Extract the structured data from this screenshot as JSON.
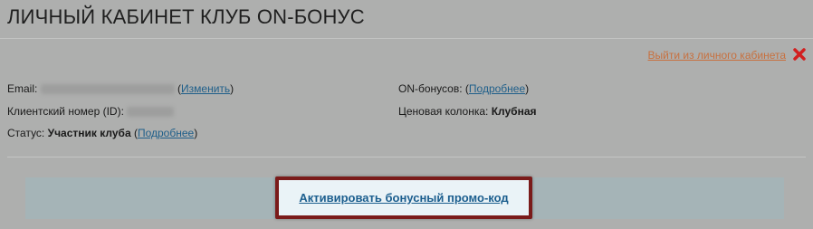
{
  "header": {
    "title": "ЛИЧНЫЙ КАБИНЕТ КЛУБ ON-БОНУС"
  },
  "logout": {
    "label": "Выйти из личного кабинета",
    "icon": "close-icon",
    "color": "#c8703e"
  },
  "account": {
    "email_label": "Email:",
    "email_change_link": "Изменить",
    "client_id_label": "Клиентский номер (ID):",
    "status_label": "Статус:",
    "status_value": "Участник клуба",
    "status_more_link": "Подробнее",
    "bonuses_label": "ON-бонусов:",
    "bonuses_more_link": "Подробнее",
    "price_column_label": "Ценовая колонка:",
    "price_column_value": "Клубная"
  },
  "promo": {
    "activate_label": "Активировать бонусный промо-код",
    "highlight_color": "#7a1b1a"
  }
}
